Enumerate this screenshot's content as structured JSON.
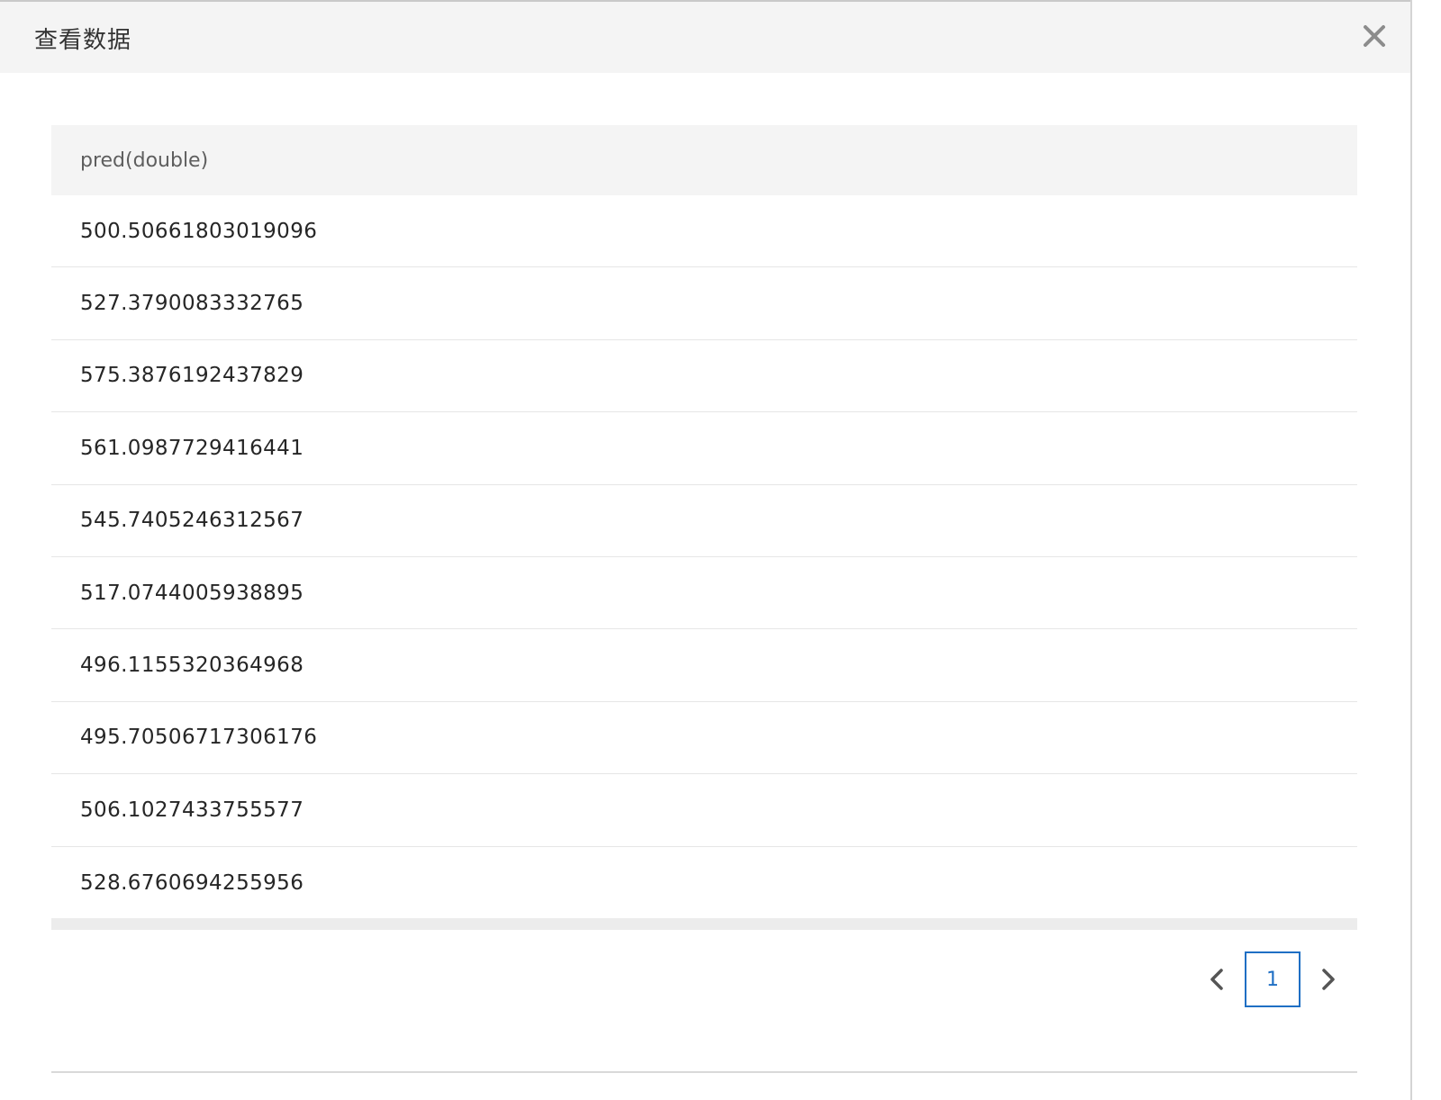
{
  "dialog": {
    "title": "查看数据",
    "close_icon": "close-icon"
  },
  "table": {
    "columns": [
      "pred(double)"
    ],
    "rows": [
      "500.50661803019096",
      "527.3790083332765",
      "575.3876192437829",
      "561.0987729416441",
      "545.7405246312567",
      "517.0744005938895",
      "496.1155320364968",
      "495.70506717306176",
      "506.1027433755577",
      "528.6760694255956"
    ]
  },
  "pagination": {
    "prev_icon": "chevron-left-icon",
    "current_page": "1",
    "next_icon": "chevron-right-icon",
    "accent_color": "#1f6fc4"
  }
}
